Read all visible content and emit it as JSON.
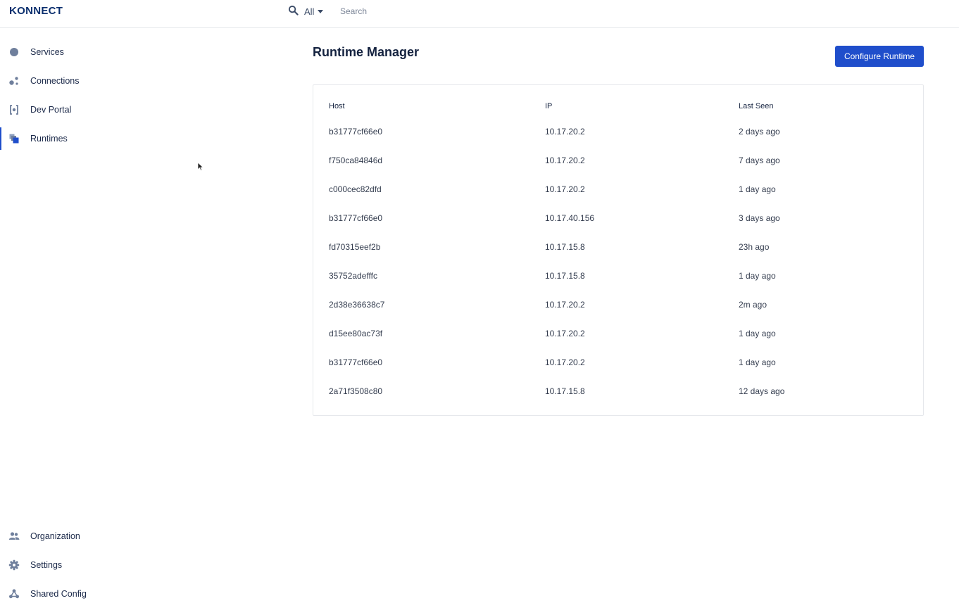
{
  "header": {
    "logo": "KONNECT",
    "scope": "All",
    "search_placeholder": "Search",
    "search_value": ""
  },
  "sidebar": {
    "top_items": [
      {
        "label": "Services",
        "icon": "services-icon"
      },
      {
        "label": "Connections",
        "icon": "connections-icon"
      },
      {
        "label": "Dev Portal",
        "icon": "dev-portal-icon"
      },
      {
        "label": "Runtimes",
        "icon": "runtimes-icon",
        "active": true
      }
    ],
    "bottom_items": [
      {
        "label": "Organization",
        "icon": "organization-icon"
      },
      {
        "label": "Settings",
        "icon": "gear-icon"
      },
      {
        "label": "Shared Config",
        "icon": "shared-config-icon"
      }
    ]
  },
  "main": {
    "title": "Runtime Manager",
    "configure_label": "Configure Runtime",
    "table": {
      "columns": [
        "Host",
        "IP",
        "Last Seen"
      ],
      "rows": [
        {
          "host": "b31777cf66e0",
          "ip": "10.17.20.2",
          "last_seen": "2 days ago"
        },
        {
          "host": "f750ca84846d",
          "ip": "10.17.20.2",
          "last_seen": "7 days ago"
        },
        {
          "host": "c000cec82dfd",
          "ip": "10.17.20.2",
          "last_seen": "1 day ago"
        },
        {
          "host": "b31777cf66e0",
          "ip": "10.17.40.156",
          "last_seen": "3 days ago"
        },
        {
          "host": "fd70315eef2b",
          "ip": "10.17.15.8",
          "last_seen": "23h ago"
        },
        {
          "host": "35752adefffc",
          "ip": "10.17.15.8",
          "last_seen": "1 day ago"
        },
        {
          "host": "2d38e36638c7",
          "ip": "10.17.20.2",
          "last_seen": "2m ago"
        },
        {
          "host": "d15ee80ac73f",
          "ip": "10.17.20.2",
          "last_seen": "1 day ago"
        },
        {
          "host": "b31777cf66e0",
          "ip": "10.17.20.2",
          "last_seen": "1 day ago"
        },
        {
          "host": "2a71f3508c80",
          "ip": "10.17.15.8",
          "last_seen": "12 days ago"
        }
      ]
    }
  },
  "colors": {
    "accent": "#1f4ecb",
    "icon": "#6f7f9c",
    "text": "#1c2a4a"
  }
}
